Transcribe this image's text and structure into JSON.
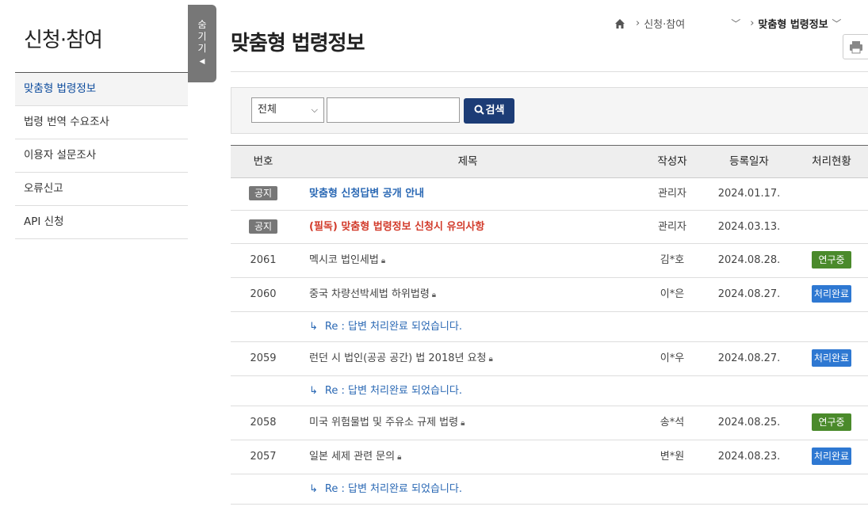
{
  "sidebar": {
    "title": "신청·참여",
    "items": [
      {
        "label": "맞춤형 법령정보"
      },
      {
        "label": "법령 번역 수요조사"
      },
      {
        "label": "이용자 설문조사"
      },
      {
        "label": "오류신고"
      },
      {
        "label": "API 신청"
      }
    ],
    "hide_label": [
      "숨",
      "기",
      "기"
    ]
  },
  "page": {
    "title": "맞춤형 법령정보",
    "breadcrumb": [
      "신청·참여",
      "맞춤형 법령정보"
    ]
  },
  "search": {
    "select_value": "전체",
    "input_value": "",
    "button_label": "검색"
  },
  "table": {
    "headers": [
      "번호",
      "제목",
      "작성자",
      "등록일자",
      "처리현황"
    ],
    "rows": [
      {
        "num": "공지",
        "title": "맞춤형 신청답변 공개 안내",
        "author": "관리자",
        "date": "2024.01.17.",
        "status": "",
        "kind": "notice-blue"
      },
      {
        "num": "공지",
        "title": "(필독) 맞춤형 법령정보 신청시 유의사항",
        "author": "관리자",
        "date": "2024.03.13.",
        "status": "",
        "kind": "notice-red"
      },
      {
        "num": "2061",
        "title": "멕시코 법인세법",
        "author": "김*호",
        "date": "2024.08.28.",
        "status": "연구중",
        "kind": "post"
      },
      {
        "num": "2060",
        "title": "중국 차량선박세법 하위법령",
        "author": "이*은",
        "date": "2024.08.27.",
        "status": "처리완료",
        "kind": "post"
      },
      {
        "num": "",
        "title": "Re : 답변 처리완료 되었습니다.",
        "author": "",
        "date": "",
        "status": "",
        "kind": "reply"
      },
      {
        "num": "2059",
        "title": "런던 시 법인(공공 공간) 법 2018년 요청",
        "author": "이*우",
        "date": "2024.08.27.",
        "status": "처리완료",
        "kind": "post"
      },
      {
        "num": "",
        "title": "Re : 답변 처리완료 되었습니다.",
        "author": "",
        "date": "",
        "status": "",
        "kind": "reply"
      },
      {
        "num": "2058",
        "title": "미국 위험물법 및 주유소 규제 법령",
        "author": "송*석",
        "date": "2024.08.25.",
        "status": "연구중",
        "kind": "post"
      },
      {
        "num": "2057",
        "title": "일본 세제 관련 문의",
        "author": "변*원",
        "date": "2024.08.23.",
        "status": "처리완료",
        "kind": "post"
      },
      {
        "num": "",
        "title": "Re : 답변 처리완료 되었습니다.",
        "author": "",
        "date": "",
        "status": "",
        "kind": "reply"
      }
    ]
  },
  "colors": {
    "accent": "#1c3c76",
    "notice_blue": "#2a68b4",
    "notice_red": "#d23b2b",
    "status_research": "#4a8a2b",
    "status_done": "#2e78d2"
  }
}
